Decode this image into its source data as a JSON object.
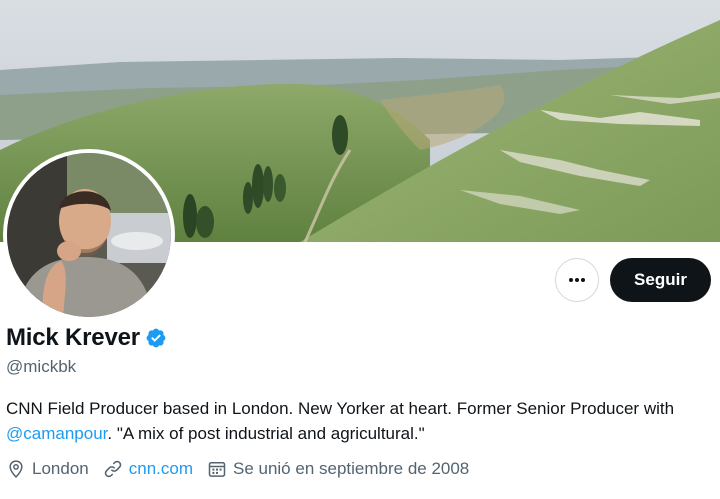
{
  "profile": {
    "display_name": "Mick Krever",
    "handle": "@mickbk",
    "verified": true
  },
  "actions": {
    "more_label": "•••",
    "follow_label": "Seguir"
  },
  "bio": {
    "text_before": "CNN Field Producer based in London. New Yorker at heart. Former Senior Producer with ",
    "mention": "@camanpour",
    "text_after": ". \"A mix of post industrial and agricultural.\""
  },
  "meta": {
    "location": "London",
    "website": "cnn.com",
    "joined": "Se unió en septiembre de 2008"
  },
  "icons": {
    "verified": "verified-badge-icon",
    "more": "more-dots-icon",
    "location": "location-pin-icon",
    "link": "link-icon",
    "calendar": "calendar-icon"
  },
  "colors": {
    "accent": "#1d9bf0",
    "primary_text": "#0f1419",
    "secondary_text": "#536471",
    "follow_bg": "#0f1419"
  }
}
